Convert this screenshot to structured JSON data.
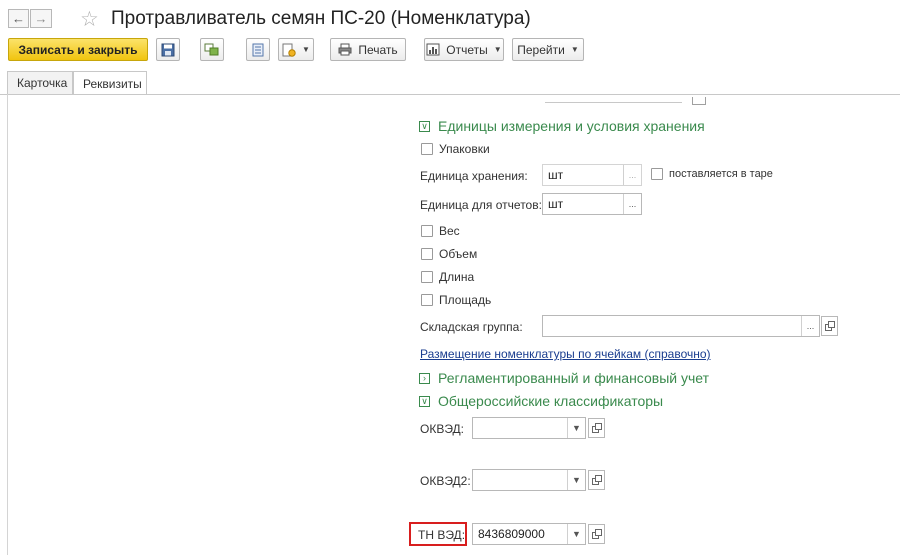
{
  "window": {
    "title": "Протравливатель семян ПС-20 (Номенклатура)"
  },
  "toolbar": {
    "save_close_label": "Записать и закрыть",
    "print_label": "Печать",
    "reports_label": "Отчеты",
    "goto_label": "Перейти"
  },
  "tabs": [
    {
      "label": "Карточка",
      "active": false
    },
    {
      "label": "Реквизиты",
      "active": true
    }
  ],
  "units_section": {
    "title": "Единицы измерения и условия хранения",
    "packages_label": "Упаковки",
    "storage_unit_label": "Единица хранения:",
    "storage_unit_value": "шт",
    "in_tare_label": "поставляется в таре",
    "report_unit_label": "Единица для отчетов:",
    "report_unit_value": "шт",
    "weight_label": "Вес",
    "volume_label": "Объем",
    "length_label": "Длина",
    "area_label": "Площадь",
    "warehouse_group_label": "Складская группа:",
    "warehouse_group_value": "",
    "cells_link": "Размещение номенклатуры по ячейкам (справочно)"
  },
  "regulated_section": {
    "title": "Регламентированный и финансовый учет",
    "expanded": false
  },
  "classifiers_section": {
    "title": "Общероссийские классификаторы",
    "expanded": true,
    "okved_label": "ОКВЭД:",
    "okved_value": "",
    "okved2_label": "ОКВЭД2:",
    "okved2_value": "",
    "tnved_label": "ТН ВЭД:",
    "tnved_value": "8436809000"
  },
  "colors": {
    "section_header": "#3a8a4d",
    "primary_button": "#f1c40f",
    "link": "#1a3d8f",
    "highlight": "#d81e1e"
  }
}
